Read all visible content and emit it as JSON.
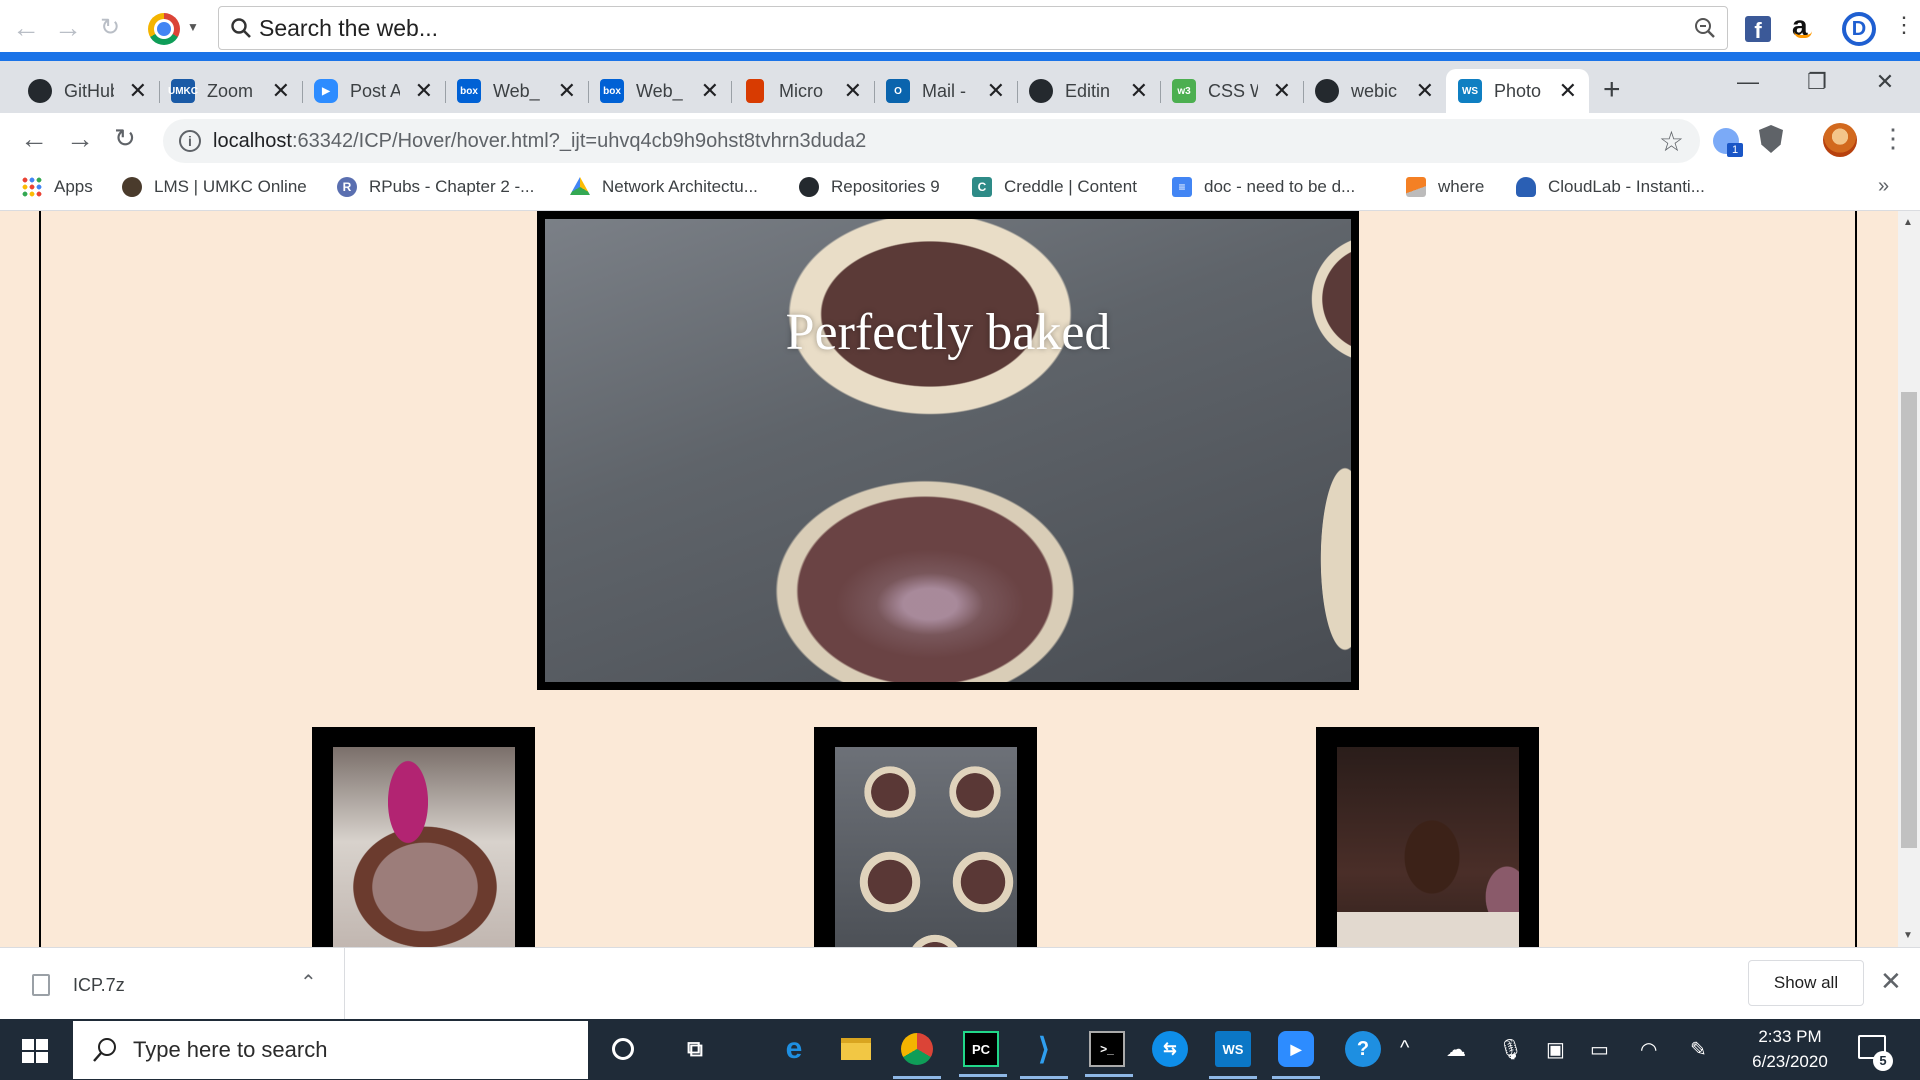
{
  "toolbar": {
    "search_placeholder": "Search the web...",
    "facebook_letter": "f",
    "amazon_letter": "a",
    "profile_letter": "D"
  },
  "tabs": [
    {
      "label": "GitHub",
      "icon": "github-icon",
      "color": "#24292e"
    },
    {
      "label": "Zoom",
      "icon": "umkc-icon",
      "color": "#1a5aa6"
    },
    {
      "label": "Post A",
      "icon": "zoom-icon",
      "color": "#2d8cff"
    },
    {
      "label": "Web_",
      "icon": "box-icon",
      "color": "#0061d5"
    },
    {
      "label": "Web_",
      "icon": "box-icon",
      "color": "#0061d5"
    },
    {
      "label": "Micro",
      "icon": "office-icon",
      "color": "#d83b01"
    },
    {
      "label": "Mail -",
      "icon": "outlook-icon",
      "color": "#0a64ad"
    },
    {
      "label": "Editin",
      "icon": "github-icon",
      "color": "#24292e"
    },
    {
      "label": "CSS W",
      "icon": "w3schools-icon",
      "color": "#4caf50"
    },
    {
      "label": "webic",
      "icon": "github-icon",
      "color": "#24292e"
    },
    {
      "label": "Photo",
      "icon": "webstorm-icon",
      "color": "#0f7fc2",
      "active": true
    }
  ],
  "window": {
    "minimize": "—",
    "restore": "❐",
    "close": "✕"
  },
  "address": {
    "host": "localhost",
    "path": ":63342/ICP/Hover/hover.html?_ijt=uhvq4cb9h9ohst8tvhrn3duda2",
    "extension_badge": "1"
  },
  "bookmarks": [
    {
      "label": "Apps",
      "icon": "apps-grid-icon"
    },
    {
      "label": "LMS | UMKC Online",
      "icon": "umkc-icon"
    },
    {
      "label": "RPubs - Chapter 2 -...",
      "icon": "rpubs-icon"
    },
    {
      "label": "Network Architectu...",
      "icon": "google-drive-icon"
    },
    {
      "label": "Repositories 9",
      "icon": "github-icon"
    },
    {
      "label": "Creddle | Content",
      "icon": "creddle-icon"
    },
    {
      "label": "doc - need to be d...",
      "icon": "google-docs-icon"
    },
    {
      "label": "where",
      "icon": "stackoverflow-icon"
    },
    {
      "label": "CloudLab - Instanti...",
      "icon": "cloudlab-icon"
    }
  ],
  "page": {
    "hero_caption": "Perfectly baked",
    "thumbnails": [
      "batter-bowl",
      "cupcake-tin",
      "frosted-cupcake"
    ]
  },
  "downloads": {
    "file_name": "ICP.7z",
    "show_all": "Show all"
  },
  "taskbar": {
    "search_placeholder": "Type here to search",
    "time": "2:33 PM",
    "date": "6/23/2020",
    "notification_count": "5"
  }
}
